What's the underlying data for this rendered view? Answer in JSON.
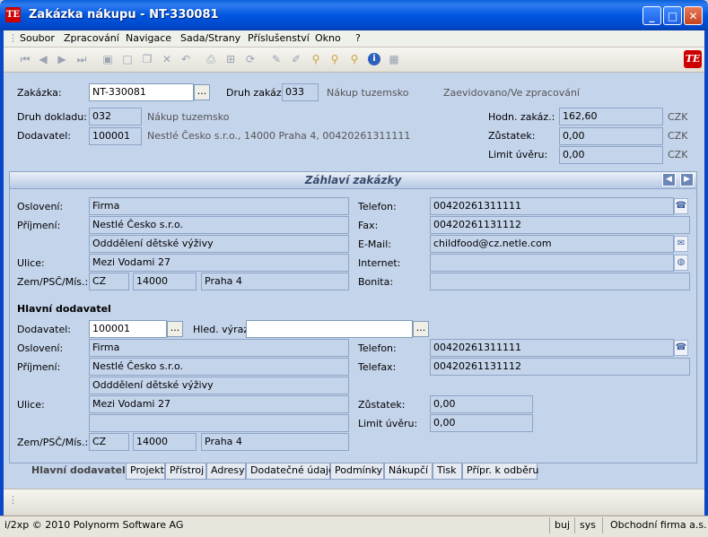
{
  "window": {
    "title": "Zakázka nákupu - NT-330081",
    "app_icon": "TE"
  },
  "menu": [
    "Soubor",
    "Zpracování",
    "Navigace",
    "Sada/Strany",
    "Příslušenství",
    "Okno",
    "?"
  ],
  "toolbar": {
    "icons": [
      "first-icon",
      "prev-icon",
      "next-icon",
      "last-icon",
      "save-icon",
      "new-icon",
      "copy-icon",
      "delete-icon",
      "undo-icon",
      "print-icon",
      "tree-icon",
      "refresh-icon",
      "edit-icon",
      "edit2-icon",
      "find-icon",
      "search-icon",
      "zoom-icon",
      "info-icon",
      "calc-icon"
    ],
    "logo": "TE"
  },
  "header": {
    "zakazka_label": "Zakázka:",
    "zakazka_value": "NT-330081",
    "druh_zakazky_label": "Druh zakáz.:",
    "druh_zakazky_value": "033",
    "druh_zakazky_text": "Nákup tuzemsko",
    "stav": "Zaevidovano/Ve zpracování",
    "druh_dokladu_label": "Druh dokladu:",
    "druh_dokladu_value": "032",
    "druh_dokladu_text": "Nákup tuzemsko",
    "dodavatel_label": "Dodavatel:",
    "dodavatel_value": "100001",
    "dodavatel_text": "Nestlé Česko s.r.o., 14000 Praha 4, 00420261311111",
    "hodn_label": "Hodn. zakáz.:",
    "hodn_value": "162,60",
    "zustatek_label": "Zůstatek:",
    "zustatek_value": "0,00",
    "limit_label": "Limit úvěru:",
    "limit_value": "0,00",
    "currency": "CZK"
  },
  "section": {
    "title": "Záhlaví zakázky"
  },
  "customer": {
    "osloveni_label": "Oslovení:",
    "osloveni": "Firma",
    "prijmeni_label": "Příjmení:",
    "prijmeni": "Nestlé Česko s.r.o.",
    "oddeleni": "Odddělení dětské výživy",
    "ulice_label": "Ulice:",
    "ulice": "Mezi Vodami 27",
    "zem_label": "Zem/PSČ/Mís.:",
    "zem": "CZ",
    "psc": "14000",
    "misto": "Praha 4",
    "telefon_label": "Telefon:",
    "telefon": "00420261311111",
    "fax_label": "Fax:",
    "fax": "00420261131112",
    "email_label": "E-Mail:",
    "email": "childfood@cz.netle.com",
    "internet_label": "Internet:",
    "internet": "",
    "bonita_label": "Bonita:",
    "bonita": ""
  },
  "supplier": {
    "heading": "Hlavní dodavatel",
    "dodavatel_label": "Dodavatel:",
    "dodavatel": "100001",
    "hled_label": "Hled. výraz:",
    "hled": "",
    "osloveni_label": "Oslovení:",
    "osloveni": "Firma",
    "prijmeni_label": "Příjmení:",
    "prijmeni": "Nestlé Česko s.r.o.",
    "oddeleni": "Odddělení dětské výživy",
    "ulice_label": "Ulice:",
    "ulice": "Mezi Vodami 27",
    "ulice2": "",
    "zem_label": "Zem/PSČ/Mís.:",
    "zem": "CZ",
    "psc": "14000",
    "misto": "Praha 4",
    "telefon_label": "Telefon:",
    "telefon": "00420261311111",
    "telefax_label": "Telefax:",
    "telefax": "00420261131112",
    "zustatek_label": "Zůstatek:",
    "zustatek": "0,00",
    "limit_label": "Limit úvěru:",
    "limit": "0,00"
  },
  "tabs": [
    "Hlavní dodavatel",
    "Projekt",
    "Přístroj",
    "Adresy",
    "Dodatečné údaje",
    "Podmínky",
    "Nákupčí",
    "Tisk",
    "Přípr. k odběru"
  ],
  "status": {
    "copyright": "i/2xp © 2010 Polynorm Software AG",
    "user": "buj",
    "system": "sys",
    "company": "Obchodní firma a.s."
  },
  "colors": {
    "titlebar": "#0057e0",
    "client": "#c4d4eb"
  }
}
